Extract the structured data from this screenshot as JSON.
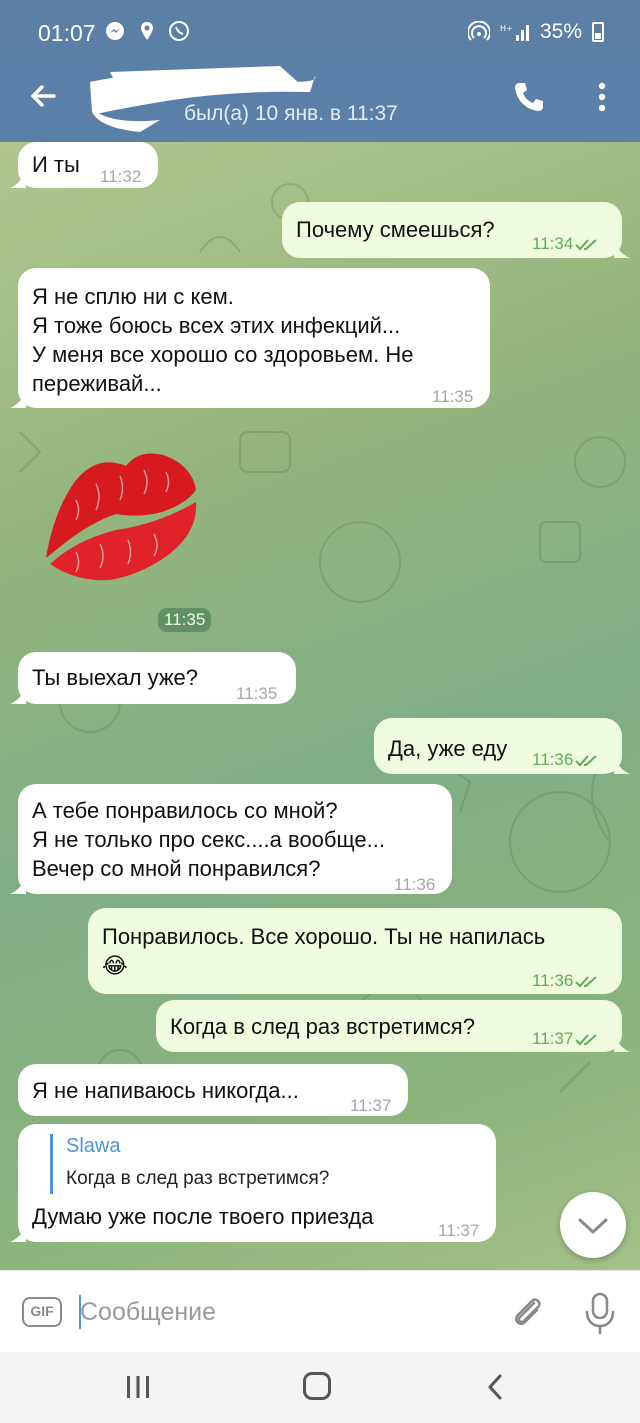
{
  "status_bar": {
    "time": "01:07",
    "battery": "35%"
  },
  "header": {
    "last_seen": "был(а) 10 янв. в 11:37"
  },
  "messages": [
    {
      "dir": "in",
      "text": "И ты",
      "time": "11:32"
    },
    {
      "dir": "out",
      "text": "Почему смеешься?",
      "time": "11:34"
    },
    {
      "dir": "in",
      "text": "Я не сплю ни с кем.\nЯ тоже боюсь всех этих инфекций...\nУ меня все хорошо со здоровьем.  Не\nпереживай...",
      "time": "11:35"
    },
    {
      "dir": "in",
      "sticker": "lips-sticker",
      "time": "11:35"
    },
    {
      "dir": "in",
      "text": "Ты выехал  уже?",
      "time": "11:35"
    },
    {
      "dir": "out",
      "text": "Да, уже еду",
      "time": "11:36"
    },
    {
      "dir": "in",
      "text": "А тебе понравилось со мной?\nЯ не только про секс....а вообще...\nВечер со мной понравился?",
      "time": "11:36"
    },
    {
      "dir": "out",
      "text": "Понравилось. Все хорошо. Ты не напилась\n😂",
      "time": "11:36"
    },
    {
      "dir": "out",
      "text": "Когда в след раз встретимся?",
      "time": "11:37"
    },
    {
      "dir": "in",
      "text": "Я не напиваюсь никогда...",
      "time": "11:37"
    },
    {
      "dir": "in",
      "reply_name": "Slawa",
      "reply_text": "Когда в след раз встретимся?",
      "text": "Думаю уже после твоего приезда",
      "time": "11:37"
    }
  ],
  "input": {
    "gif_label": "GIF",
    "placeholder": "Сообщение"
  },
  "colors": {
    "header": "#5a80a7",
    "incoming": "#ffffff",
    "outgoing": "#effdde",
    "accent": "#4e94d8"
  }
}
